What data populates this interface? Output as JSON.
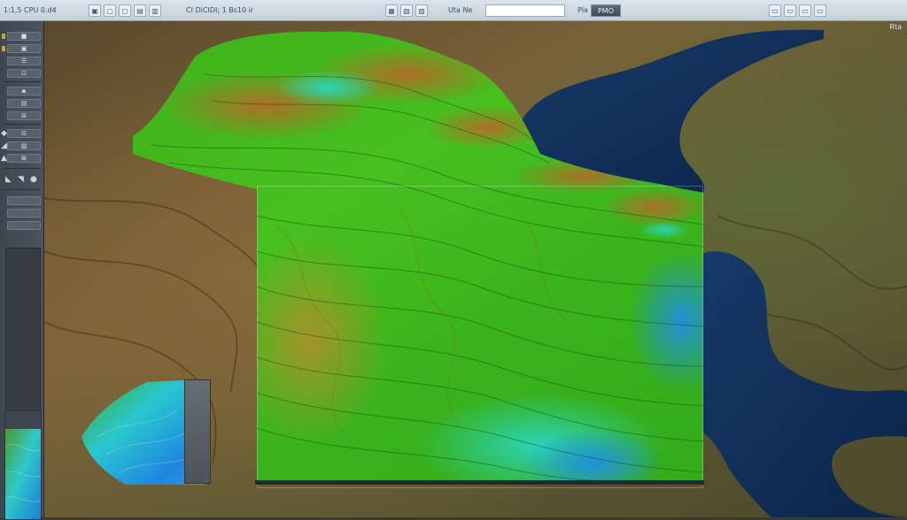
{
  "toolbar": {
    "left_text": "1:1,5 CPU  0.d4",
    "tools": [
      "▣",
      "▢",
      "◻",
      "▤",
      "▥"
    ],
    "mid_text": "CI DiCIDI; 1 Bs10  ir",
    "right_tools": [
      "▦",
      "▧",
      "▨"
    ],
    "label_a": "Uta Ne",
    "label_b": "PMO",
    "search": {
      "value": "",
      "placeholder": ""
    },
    "preview_label": "Pla"
  },
  "left_panel": {
    "tools": [
      "■",
      "▣",
      "☰",
      "⊡",
      "▪",
      "▤",
      "⊞",
      "⊟",
      "▥",
      "⊠"
    ],
    "icons": [
      "◆",
      "◢",
      "▲",
      "◣",
      "◥",
      "●"
    ]
  },
  "map": {
    "corner_label": "Rta",
    "colors": {
      "water": "#0f2c52",
      "land_dark": "#5a4a2c",
      "land_mid": "#7a6238",
      "terrain_green": "#3cb21a",
      "terrain_cyan": "#2ad7c0",
      "terrain_blue": "#1f8ee3",
      "terrain_brown": "#b46a27"
    }
  }
}
